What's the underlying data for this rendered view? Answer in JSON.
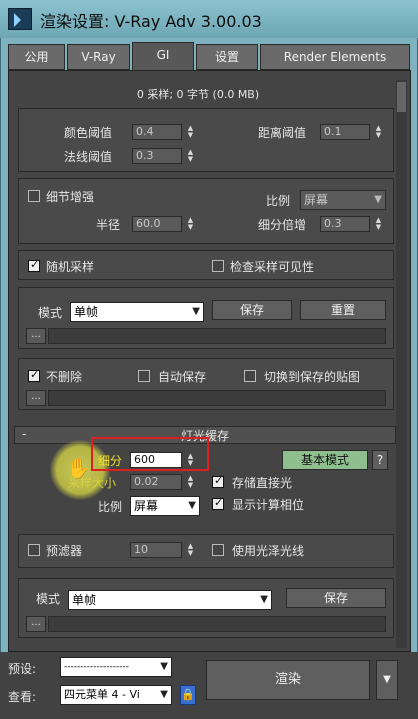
{
  "window": {
    "title": "渲染设置: V-Ray Adv 3.00.03"
  },
  "tabs": [
    "公用",
    "V-Ray",
    "GI",
    "设置",
    "Render Elements"
  ],
  "active_tab": "GI",
  "summary": "0 采样; 0 字节 (0.0 MB)",
  "irradiance": {
    "color_threshold_label": "颜色阈值",
    "color_threshold": "0.4",
    "normal_threshold_label": "法线阈值",
    "normal_threshold": "0.3",
    "dist_threshold_label": "距离阈值",
    "dist_threshold": "0.1"
  },
  "detail": {
    "enhance_label": "细节增强",
    "scale_label": "比例",
    "scale_value": "屏幕",
    "radius_label": "半径",
    "radius": "60.0",
    "subdiv_mult_label": "细分倍增",
    "subdiv_mult": "0.3"
  },
  "options": {
    "random_label": "随机采样",
    "check_visibility_label": "检查采样可见性"
  },
  "mode1": {
    "label": "模式",
    "value": "单帧",
    "save": "保存",
    "reset": "重置",
    "browse": "..."
  },
  "ondone": {
    "dont_delete": "不删除",
    "auto_save": "自动保存",
    "switch_saved": "切换到保存的贴图",
    "browse": "..."
  },
  "light_cache": {
    "header": "灯光缓存",
    "collapse": "-",
    "subdivs_label": "细分",
    "subdivs": "600",
    "basic_mode": "基本模式",
    "help": "?",
    "sample_size_label": "采样大小",
    "sample_size": "0.02",
    "store_direct_label": "存储直接光",
    "scale_label": "比例",
    "scale_value": "屏幕",
    "show_calc_label": "显示计算相位",
    "prefilter_label": "预滤器",
    "prefilter": "10",
    "glossy_label": "使用光泽光线",
    "mode_label": "模式",
    "mode_value": "单帧",
    "save": "保存",
    "browse": "..."
  },
  "bottom": {
    "preset_label": "预设:",
    "preset_value": "--------------------",
    "view_label": "查看:",
    "view_value": "四元菜单 4 - Vi",
    "render": "渲染"
  }
}
